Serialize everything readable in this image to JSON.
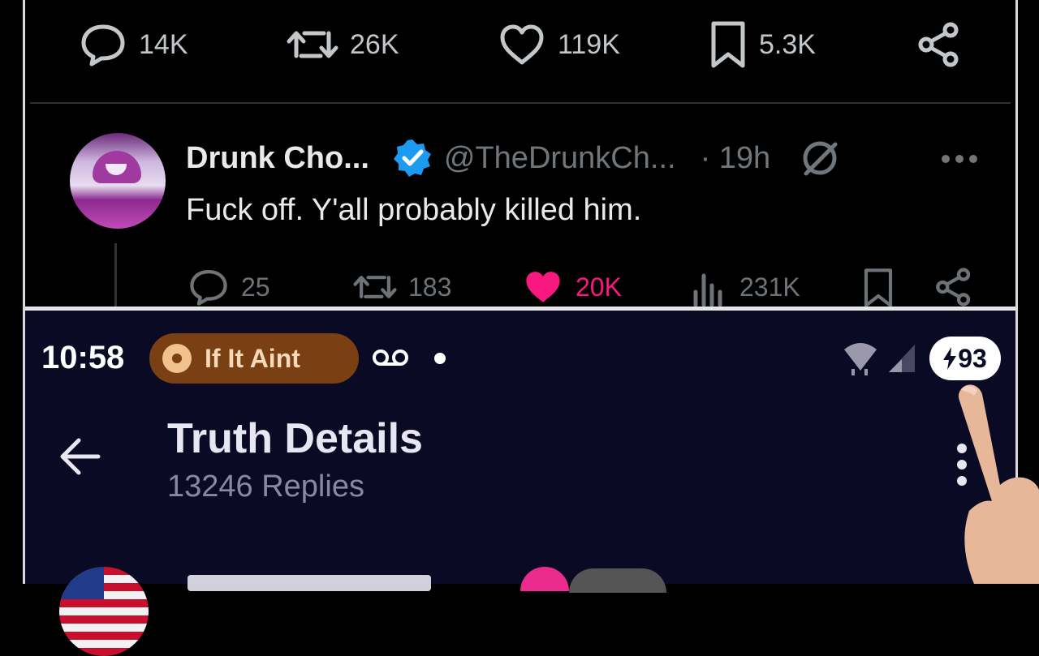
{
  "x_post": {
    "actions": [
      {
        "icon": "reply-icon",
        "count": "14K"
      },
      {
        "icon": "repost-icon",
        "count": "26K"
      },
      {
        "icon": "like-icon",
        "count": "119K"
      },
      {
        "icon": "bookmark-icon",
        "count": "5.3K"
      },
      {
        "icon": "share-icon",
        "count": ""
      }
    ]
  },
  "reply": {
    "display_name": "Drunk Cho...",
    "handle": "@TheDrunkCh...",
    "time": "· 19h",
    "text": "Fuck off. Y'all probably killed him.",
    "actions": {
      "replies": "25",
      "reposts": "183",
      "likes": "20K",
      "views": "231K"
    },
    "like_color": "#f91880"
  },
  "truth_screen": {
    "status_bar": {
      "time": "10:58",
      "media_pill": "If It Aint",
      "battery": "93"
    },
    "title": "Truth Details",
    "subtitle": "13246 Replies"
  }
}
